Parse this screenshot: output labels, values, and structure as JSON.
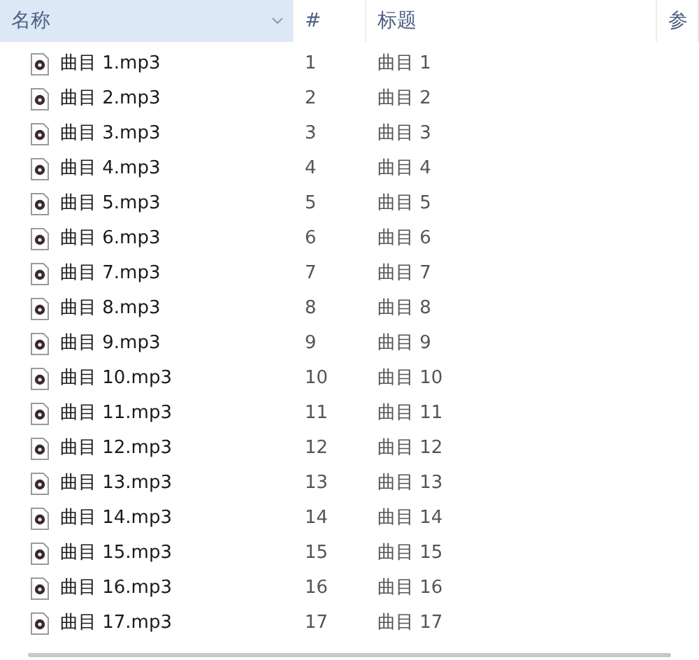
{
  "columns": [
    {
      "label": "名称",
      "sorted": true
    },
    {
      "label": "#",
      "sorted": false
    },
    {
      "label": "标题",
      "sorted": false
    },
    {
      "label": "参",
      "sorted": false
    }
  ],
  "rows": [
    {
      "name": "曲目 1.mp3",
      "number": "1",
      "title": "曲目 1"
    },
    {
      "name": "曲目 2.mp3",
      "number": "2",
      "title": "曲目 2"
    },
    {
      "name": "曲目 3.mp3",
      "number": "3",
      "title": "曲目 3"
    },
    {
      "name": "曲目 4.mp3",
      "number": "4",
      "title": "曲目 4"
    },
    {
      "name": "曲目 5.mp3",
      "number": "5",
      "title": "曲目 5"
    },
    {
      "name": "曲目 6.mp3",
      "number": "6",
      "title": "曲目 6"
    },
    {
      "name": "曲目 7.mp3",
      "number": "7",
      "title": "曲目 7"
    },
    {
      "name": "曲目 8.mp3",
      "number": "8",
      "title": "曲目 8"
    },
    {
      "name": "曲目 9.mp3",
      "number": "9",
      "title": "曲目 9"
    },
    {
      "name": "曲目 10.mp3",
      "number": "10",
      "title": "曲目 10"
    },
    {
      "name": "曲目 11.mp3",
      "number": "11",
      "title": "曲目 11"
    },
    {
      "name": "曲目 12.mp3",
      "number": "12",
      "title": "曲目 12"
    },
    {
      "name": "曲目 13.mp3",
      "number": "13",
      "title": "曲目 13"
    },
    {
      "name": "曲目 14.mp3",
      "number": "14",
      "title": "曲目 14"
    },
    {
      "name": "曲目 15.mp3",
      "number": "15",
      "title": "曲目 15"
    },
    {
      "name": "曲目 16.mp3",
      "number": "16",
      "title": "曲目 16"
    },
    {
      "name": "曲目 17.mp3",
      "number": "17",
      "title": "曲目 17"
    }
  ]
}
